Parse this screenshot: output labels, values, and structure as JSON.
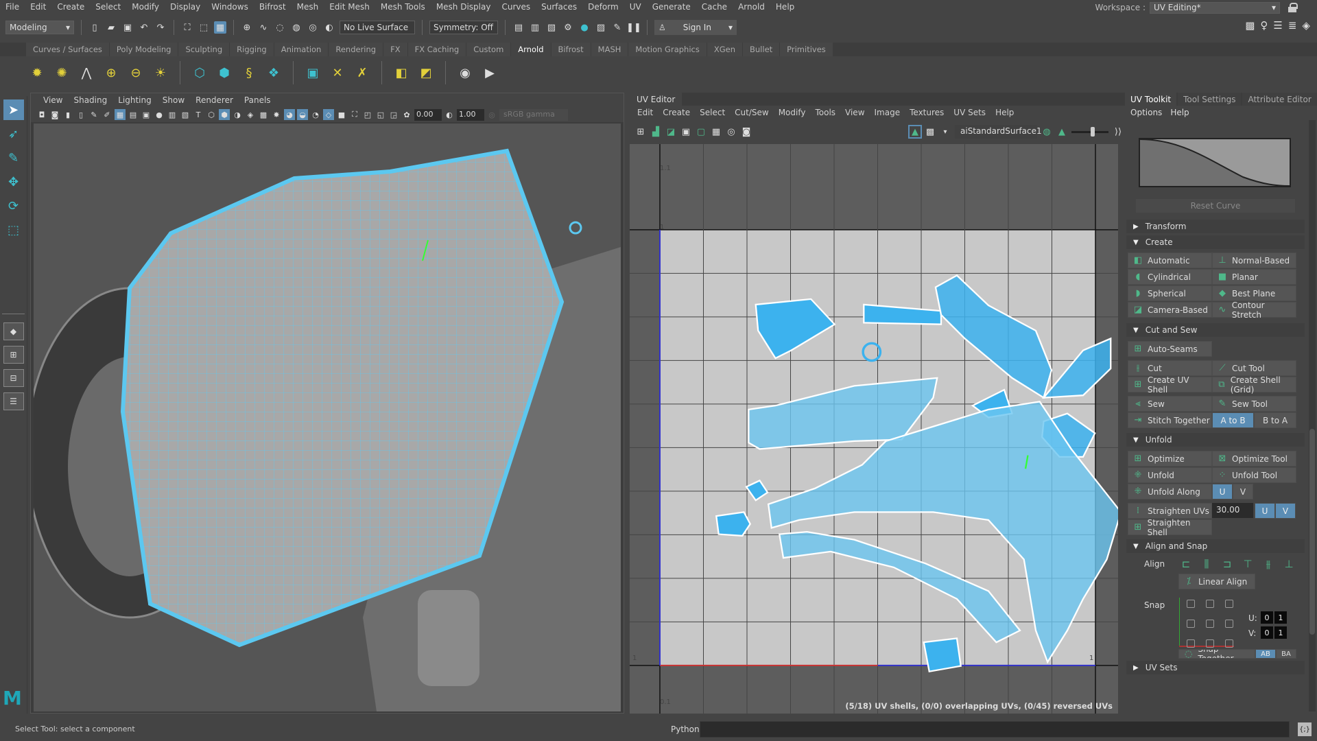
{
  "menubar": {
    "items": [
      "File",
      "Edit",
      "Create",
      "Select",
      "Modify",
      "Display",
      "Windows",
      "Bifrost",
      "Mesh",
      "Edit Mesh",
      "Mesh Tools",
      "Mesh Display",
      "Curves",
      "Surfaces",
      "Deform",
      "UV",
      "Generate",
      "Cache",
      "Arnold",
      "Help"
    ],
    "workspace_label": "Workspace :",
    "workspace_value": "UV Editing*"
  },
  "statusline": {
    "mode": "Modeling",
    "live_surface": "No Live Surface",
    "symmetry": "Symmetry: Off",
    "sign_in": "Sign In"
  },
  "shelf": {
    "tabs": [
      "Curves / Surfaces",
      "Poly Modeling",
      "Sculpting",
      "Rigging",
      "Animation",
      "Rendering",
      "FX",
      "FX Caching",
      "Custom",
      "Arnold",
      "Bifrost",
      "MASH",
      "Motion Graphics",
      "XGen",
      "Bullet",
      "Primitives"
    ],
    "active_tab": "Arnold"
  },
  "viewport": {
    "menu": [
      "View",
      "Shading",
      "Lighting",
      "Show",
      "Renderer",
      "Panels"
    ],
    "exposure": "0.00",
    "gamma": "1.00",
    "color_space": "sRGB gamma"
  },
  "uv_editor": {
    "title": "UV Editor",
    "menu": [
      "Edit",
      "Create",
      "Select",
      "Cut/Sew",
      "Modify",
      "Tools",
      "View",
      "Image",
      "Textures",
      "UV Sets",
      "Help"
    ],
    "texture": "aiStandardSurface1",
    "grid_labels": {
      "top_a": "1.1",
      "top_b": "1",
      "left": "1",
      "right": "1",
      "bottom": "0.1"
    },
    "status": "(5/18) UV shells, (0/0) overlapping UVs, (0/45) reversed UVs"
  },
  "uv_toolkit": {
    "tabs": [
      "UV Toolkit",
      "Tool Settings",
      "Attribute Editor"
    ],
    "active_tab": "UV Toolkit",
    "menu": [
      "Options",
      "Help"
    ],
    "reset_curve": "Reset Curve",
    "sections": {
      "transform": "Transform",
      "create": "Create",
      "cut_and_sew": "Cut and Sew",
      "unfold": "Unfold",
      "align_and_snap": "Align and Snap",
      "uv_sets": "UV Sets"
    },
    "create_buttons": [
      "Automatic",
      "Normal-Based",
      "Cylindrical",
      "Planar",
      "Spherical",
      "Best Plane",
      "Camera-Based",
      "Contour Stretch"
    ],
    "cut_sew": {
      "auto_seams": "Auto-Seams",
      "cut": "Cut",
      "cut_tool": "Cut Tool",
      "create_uv_shell": "Create UV Shell",
      "create_shell_grid": "Create Shell (Grid)",
      "sew": "Sew",
      "sew_tool": "Sew Tool",
      "stitch_together": "Stitch Together",
      "a_to_b": "A to B",
      "b_to_a": "B to A"
    },
    "unfold": {
      "optimize": "Optimize",
      "optimize_tool": "Optimize Tool",
      "unfold": "Unfold",
      "unfold_tool": "Unfold Tool",
      "unfold_along": "Unfold Along",
      "u": "U",
      "v": "V",
      "straighten_uvs": "Straighten UVs",
      "straighten_value": "30.00",
      "straighten_shell": "Straighten Shell"
    },
    "align_snap": {
      "align_label": "Align",
      "linear_align": "Linear Align",
      "snap_label": "Snap",
      "u_label": "U:",
      "v_label": "V:",
      "u_values": [
        "0",
        "1"
      ],
      "v_values": [
        "0",
        "1"
      ],
      "snap_together": "Snap Together",
      "ab": "AB",
      "ba": "BA"
    }
  },
  "bottom": {
    "help_line": "Select Tool: select a component",
    "script_lang": "Python"
  }
}
